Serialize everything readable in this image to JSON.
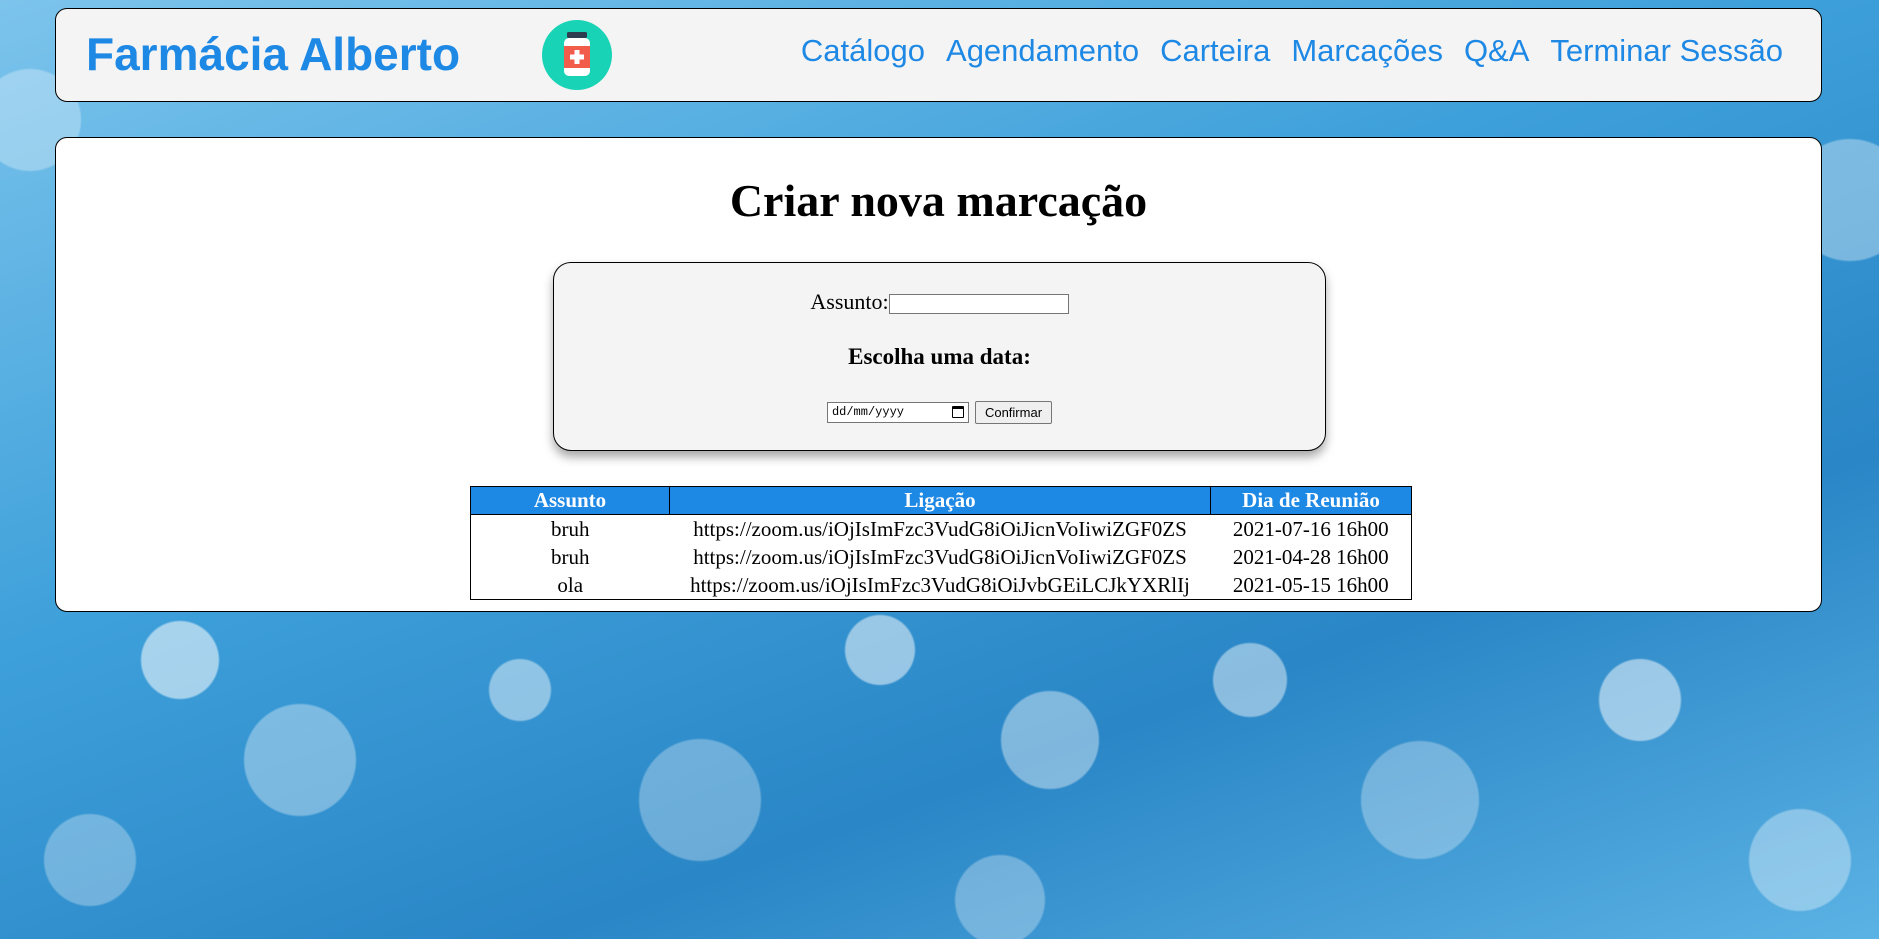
{
  "header": {
    "brand": "Farmácia Alberto",
    "logo_icon": "medicine-bottle-icon",
    "logo_color": "#19d3b6",
    "accent_color": "#1e88e5",
    "nav": [
      {
        "label": "Catálogo"
      },
      {
        "label": "Agendamento"
      },
      {
        "label": "Carteira"
      },
      {
        "label": "Marcações"
      },
      {
        "label": "Q&A"
      },
      {
        "label": "Terminar Sessão"
      }
    ]
  },
  "main": {
    "title": "Criar nova marcação",
    "form": {
      "subject_label": "Assunto:",
      "subject_value": "",
      "date_heading": "Escolha uma data:",
      "date_placeholder": "dd/mm/yyyy",
      "confirm_label": "Confirmar"
    },
    "table": {
      "headers": [
        "Assunto",
        "Ligação",
        "Dia de Reunião"
      ],
      "rows": [
        [
          "bruh",
          "https://zoom.us/iOjIsImFzc3VudG8iOiJicnVoIiwiZGF0ZS",
          "2021-07-16 16h00"
        ],
        [
          "bruh",
          "https://zoom.us/iOjIsImFzc3VudG8iOiJicnVoIiwiZGF0ZS",
          "2021-04-28 16h00"
        ],
        [
          "ola",
          "https://zoom.us/iOjIsImFzc3VudG8iOiJvbGEiLCJkYXRlIj",
          "2021-05-15 16h00"
        ]
      ]
    }
  }
}
